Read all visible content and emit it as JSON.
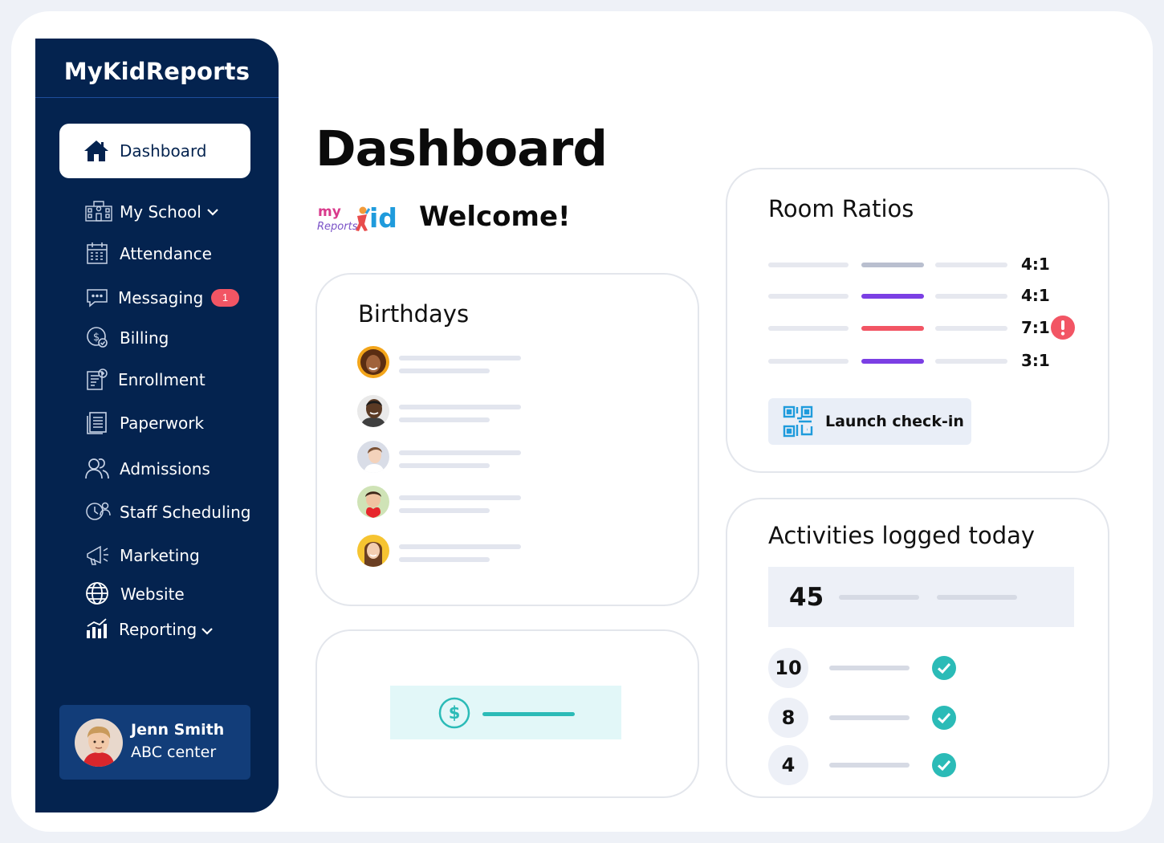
{
  "app": {
    "brand": "MyKidReports"
  },
  "sidebar": {
    "active": {
      "label": "Dashboard",
      "icon": "home-icon"
    },
    "items": [
      {
        "label": "My School",
        "icon": "school-icon",
        "has_dropdown": true
      },
      {
        "label": "Attendance",
        "icon": "calendar-icon"
      },
      {
        "label": "Messaging",
        "icon": "chat-icon",
        "badge": "1"
      },
      {
        "label": "Billing",
        "icon": "dollar-icon"
      },
      {
        "label": "Enrollment",
        "icon": "clipboard-icon"
      },
      {
        "label": "Paperwork",
        "icon": "document-icon"
      },
      {
        "label": "Admissions",
        "icon": "users-icon"
      },
      {
        "label": "Staff Scheduling",
        "icon": "clock-user-icon"
      },
      {
        "label": "Marketing",
        "icon": "megaphone-icon"
      },
      {
        "label": "Website",
        "icon": "globe-icon"
      },
      {
        "label": "Reporting",
        "icon": "bar-chart-icon",
        "has_dropdown": true
      }
    ],
    "user": {
      "name": "Jenn Smith",
      "org": "ABC center"
    }
  },
  "main": {
    "title": "Dashboard",
    "welcome": "Welcome!",
    "logo_text": {
      "my": "my",
      "reports": "Reports",
      "kid": "id"
    }
  },
  "birthdays": {
    "title": "Birthdays",
    "entries": 5
  },
  "room_ratios": {
    "title": "Room Ratios",
    "rows": [
      {
        "ratio": "4:1",
        "status_color": "#b9bfcf",
        "alert": false
      },
      {
        "ratio": "4:1",
        "status_color": "#7b3fe4",
        "alert": false
      },
      {
        "ratio": "7:1",
        "status_color": "#f25564",
        "alert": true
      },
      {
        "ratio": "3:1",
        "status_color": "#7b3fe4",
        "alert": false
      }
    ],
    "launch_label": "Launch check-in"
  },
  "activities": {
    "title": "Activities logged today",
    "total": "45",
    "items": [
      "10",
      "8",
      "4"
    ]
  },
  "colors": {
    "sidebar": "#04234f",
    "accent_teal": "#2bbbb7",
    "alert_red": "#f25564",
    "purple": "#7b3fe4"
  }
}
